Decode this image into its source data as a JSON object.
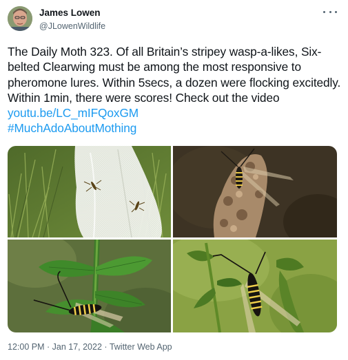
{
  "author": {
    "display_name": "James Lowen",
    "handle": "@JLowenWildlife"
  },
  "tweet": {
    "text": "The Daily Moth 323. Of all Britain’s stripey wasp-a-likes, Six-belted Clearwing must be among the most responsive to pheromone lures. Within 5secs, a dozen were flocking excitedly. Within 1min, there were scores! Check out the video ",
    "link": "youtu.be/LC_mIFQoxGM",
    "hashtag": "#MuchAdoAboutMothing"
  },
  "meta": {
    "time": "12:00 PM",
    "separator1": " · ",
    "date": "Jan 17, 2022",
    "separator2": " · ",
    "source": "Twitter Web App"
  },
  "icons": {
    "more": "more-horizontal-icon"
  },
  "colors": {
    "link": "#1d9bf0",
    "secondary_text": "#536471",
    "primary_text": "#0f1419"
  }
}
